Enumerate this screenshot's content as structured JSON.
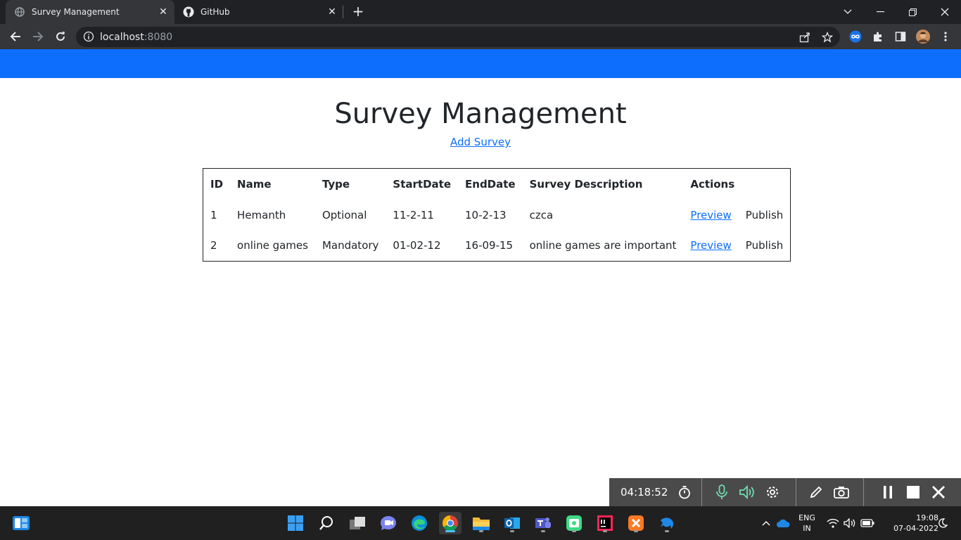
{
  "browser": {
    "tabs": [
      {
        "title": "Survey Management",
        "active": true
      },
      {
        "title": "GitHub",
        "active": false
      }
    ],
    "url_host": "localhost",
    "url_port": ":8080"
  },
  "page": {
    "title": "Survey Management",
    "add_link": "Add Survey",
    "table": {
      "headers": [
        "ID",
        "Name",
        "Type",
        "StartDate",
        "EndDate",
        "Survey Description",
        "Actions"
      ],
      "rows": [
        {
          "id": "1",
          "name": "Hemanth",
          "type": "Optional",
          "start": "11-2-11",
          "end": "10-2-13",
          "description": "czca",
          "preview": "Preview",
          "publish": "Publish"
        },
        {
          "id": "2",
          "name": "online games",
          "type": "Mandatory",
          "start": "01-02-12",
          "end": "16-09-15",
          "description": "online games are important",
          "preview": "Preview",
          "publish": "Publish"
        }
      ]
    }
  },
  "recorder": {
    "elapsed": "04:18:52"
  },
  "taskbar": {
    "lang": "ENG",
    "region": "IN",
    "time": "19:08",
    "date": "07-04-2022"
  },
  "colors": {
    "navbar": "#0d6efd",
    "link": "#0d6efd",
    "chrome_dark": "#202124",
    "chrome_toolbar": "#35363a"
  }
}
